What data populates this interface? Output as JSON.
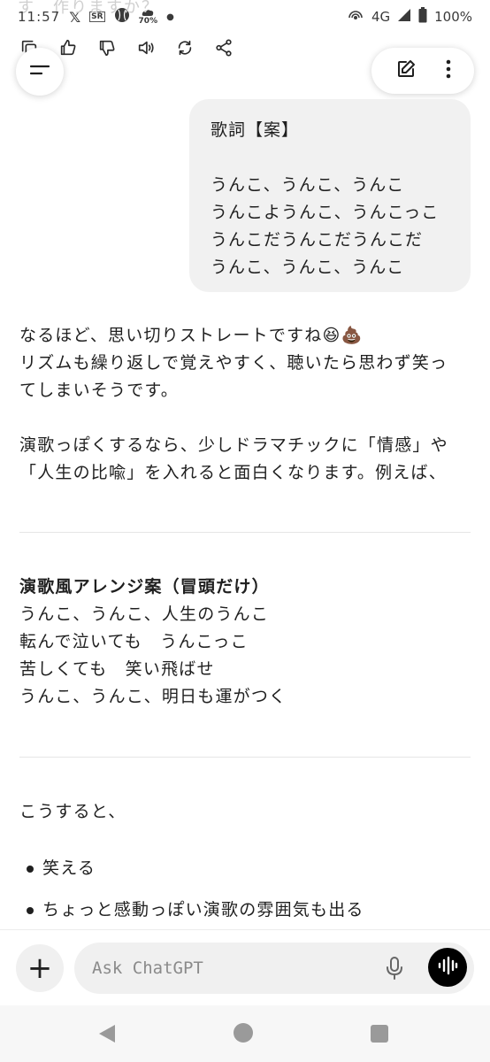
{
  "status_bar": {
    "ghost_text": "す　作りますか？",
    "time": "11:57",
    "weather_percent": "70%",
    "network": "4G",
    "battery": "100%",
    "icons": [
      "x-icon",
      "app-icon",
      "baseball-icon",
      "weather-icon",
      "dot-icon",
      "hotspot-icon",
      "signal-icon",
      "battery-icon"
    ]
  },
  "action_row": {
    "icons": [
      "copy-icon",
      "thumbs-up-icon",
      "thumbs-down-icon",
      "speaker-icon",
      "regenerate-icon",
      "share-icon"
    ]
  },
  "user_message": {
    "lines": [
      "歌詞【案】",
      "",
      "うんこ、うんこ、うんこ",
      "うんこようんこ、うんこっこ",
      "うんこだうんこだうんこだ",
      "うんこ、うんこ、うんこ"
    ]
  },
  "assistant": {
    "p1": {
      "line1": "なるほど、思い切りストレートですね😆💩",
      "line2": "リズムも繰り返しで覚えやすく、聴いたら思わず笑っ",
      "line3": "てしまいそうです。"
    },
    "p2": {
      "line1": "演歌っぽくするなら、少しドラマチックに「情感」や",
      "line2": "「人生の比喩」を入れると面白くなります。例えば、"
    },
    "arrangement": {
      "heading": "演歌風アレンジ案（冒頭だけ）",
      "line1": "うんこ、うんこ、人生のうんこ",
      "line2": "転んで泣いても　うんこっこ",
      "line3": "苦しくても　笑い飛ばせ",
      "line4": "うんこ、うんこ、明日も運がつく"
    },
    "p4": "こうすると、",
    "bullets": [
      "笑える",
      "ちょっと感動っぽい演歌の雰囲気も出る"
    ]
  },
  "input": {
    "placeholder": "Ask ChatGPT",
    "plus_label": "+"
  }
}
